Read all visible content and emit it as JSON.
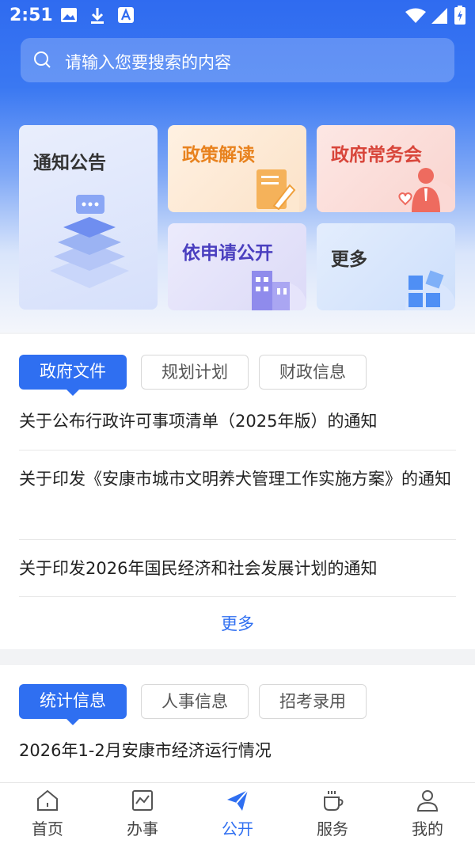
{
  "status_bar": {
    "time": "2:51"
  },
  "search": {
    "placeholder": "请输入您要搜索的内容"
  },
  "tiles": [
    {
      "label": "通知公告",
      "color": "#333333"
    },
    {
      "label": "政策解读",
      "color": "#e8821e"
    },
    {
      "label": "政府常务会",
      "color": "#d8453a"
    },
    {
      "label": "依申请公开",
      "color": "#4a3fbf"
    },
    {
      "label": "更多",
      "color": "#333333"
    }
  ],
  "section1": {
    "tabs": [
      "政府文件",
      "规划计划",
      "财政信息"
    ],
    "active_tab": 0,
    "items": [
      "关于公布行政许可事项清单（2025年版）的通知",
      "关于印发《安康市城市文明养犬管理工作实施方案》的通知",
      "关于印发2026年国民经济和社会发展计划的通知"
    ],
    "more": "更多"
  },
  "section2": {
    "tabs": [
      "统计信息",
      "人事信息",
      "招考录用"
    ],
    "active_tab": 0,
    "items": [
      "2026年1-2月安康市经济运行情况"
    ]
  },
  "bottom_nav": {
    "items": [
      {
        "label": "首页",
        "icon": "home-icon"
      },
      {
        "label": "办事",
        "icon": "chart-icon"
      },
      {
        "label": "公开",
        "icon": "paper-plane-icon"
      },
      {
        "label": "服务",
        "icon": "coffee-cup-icon"
      },
      {
        "label": "我的",
        "icon": "person-icon"
      }
    ],
    "active": 2
  },
  "colors": {
    "accent": "#2f6ff1",
    "hero_top": "#2f6bf0"
  }
}
